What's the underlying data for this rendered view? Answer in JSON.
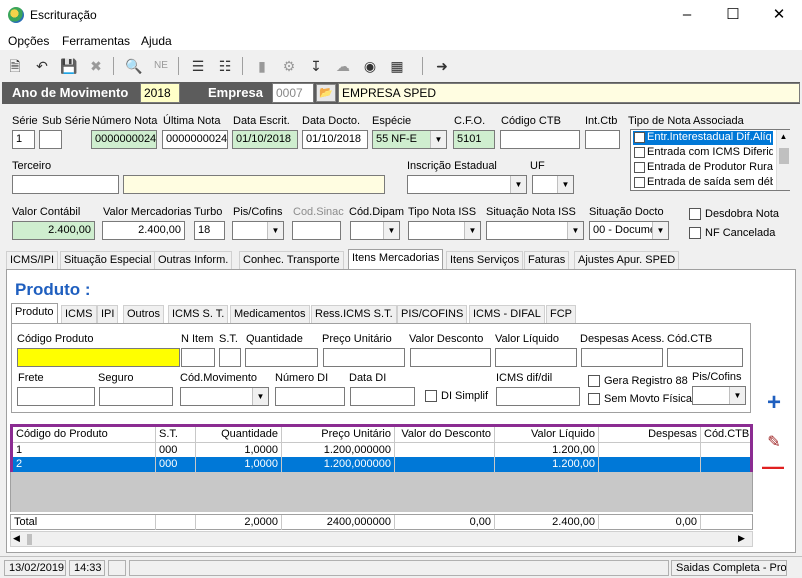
{
  "window": {
    "title": "Escrituração"
  },
  "menu": [
    "Opções",
    "Ferramentas",
    "Ajuda"
  ],
  "header": {
    "ano_label": "Ano de Movimento",
    "ano_value": "2018",
    "empresa_label": "Empresa",
    "empresa_code": "0007",
    "empresa_name": "EMPRESA SPED"
  },
  "nota": {
    "serie_label": "Série",
    "subserie_label": "Sub Série",
    "numero_label": "Número Nota",
    "ultima_label": "Última Nota",
    "dataescrit_label": "Data Escrit.",
    "datadocto_label": "Data Docto.",
    "especie_label": "Espécie",
    "cfo_label": "C.F.O.",
    "ctb_label": "Código CTB",
    "intctb_label": "Int.Ctb",
    "tiponota_label": "Tipo de Nota Associada",
    "serie": "1",
    "subserie": "",
    "numero": "0000000024",
    "ultima": "0000000024",
    "dataescrit": "01/10/2018",
    "datadocto": "01/10/2018",
    "especie": "55  NF-E",
    "cfo": "5101",
    "ctb": "",
    "intctb": "",
    "tipos": [
      "Entr.Interestadual Dif.Alíq",
      "Entrada com ICMS Diferido",
      "Entrada de Produtor Rural",
      "Entrada de saída sem débi"
    ],
    "terceiro_label": "Terceiro",
    "ie_label": "Inscrição Estadual",
    "uf_label": "UF",
    "valorcontabil_label": "Valor Contábil",
    "valormerc_label": "Valor Mercadorias",
    "turbo_label": "Turbo",
    "piscofins_label": "Pis/Cofins",
    "codsinac_label": "Cod.Sinac",
    "coddipam_label": "Cód.Dipam",
    "tipoiss_label": "Tipo Nota ISS",
    "situacaoiss_label": "Situação Nota ISS",
    "situacaodocto_label": "Situação Docto",
    "valorcontabil": "2.400,00",
    "valormerc": "2.400,00",
    "turbo": "18",
    "situacaodocto": "00 - Documen",
    "desdobra_label": "Desdobra Nota",
    "nfcancelada_label": "NF Cancelada"
  },
  "main_tabs": [
    "ICMS/IPI",
    "Situação Especial",
    "Outras Inform.",
    "Conhec. Transporte",
    "Itens Mercadorias",
    "Itens Serviços",
    "Faturas",
    "Ajustes Apur. SPED"
  ],
  "produto": {
    "title": "Produto :",
    "tabs": [
      "Produto",
      "ICMS",
      "IPI",
      "Outros",
      "ICMS S. T.",
      "Medicamentos",
      "Ress.ICMS S.T.",
      "PIS/COFINS",
      "ICMS - DIFAL",
      "FCP"
    ],
    "codigo_label": "Código Produto",
    "nitem_label": "N Item",
    "st_label": "S.T.",
    "quantidade_label": "Quantidade",
    "preco_label": "Preço Unitário",
    "desconto_label": "Valor Desconto",
    "liquido_label": "Valor Líquido",
    "despesas_label": "Despesas Acess.",
    "codctb_label": "Cód.CTB",
    "frete_label": "Frete",
    "seguro_label": "Seguro",
    "codmov_label": "Cód.Movimento",
    "numerodi_label": "Número DI",
    "datadi_label": "Data DI",
    "disimplif_label": "DI Simplif",
    "icmsdif_label": "ICMS dif/dil",
    "geraregistro_label": "Gera Registro 88",
    "semmovto_label": "Sem Movto Física",
    "piscofins_label": "Pis/Cofins"
  },
  "grid": {
    "headers": [
      "Código do Produto",
      "S.T.",
      "Quantidade",
      "Preço Unitário",
      "Valor do Desconto",
      "Valor Líquido",
      "Despesas",
      "Cód.CTB"
    ],
    "rows": [
      [
        "1",
        "000",
        "1,0000",
        "1.200,000000",
        "",
        "1.200,00",
        "",
        ""
      ],
      [
        "2",
        "000",
        "1,0000",
        "1.200,000000",
        "",
        "1.200,00",
        "",
        ""
      ]
    ],
    "totals": [
      "Total",
      "",
      "2,0000",
      "2400,000000",
      "0,00",
      "2.400,00",
      "0,00",
      ""
    ]
  },
  "status": {
    "date": "13/02/2019",
    "time": "14:33",
    "message": "Saidas Completa - Pros"
  },
  "colors": {
    "accent": "#1f5fbf",
    "highlight": "#8b2c92",
    "selected_row": "#0078d7"
  }
}
